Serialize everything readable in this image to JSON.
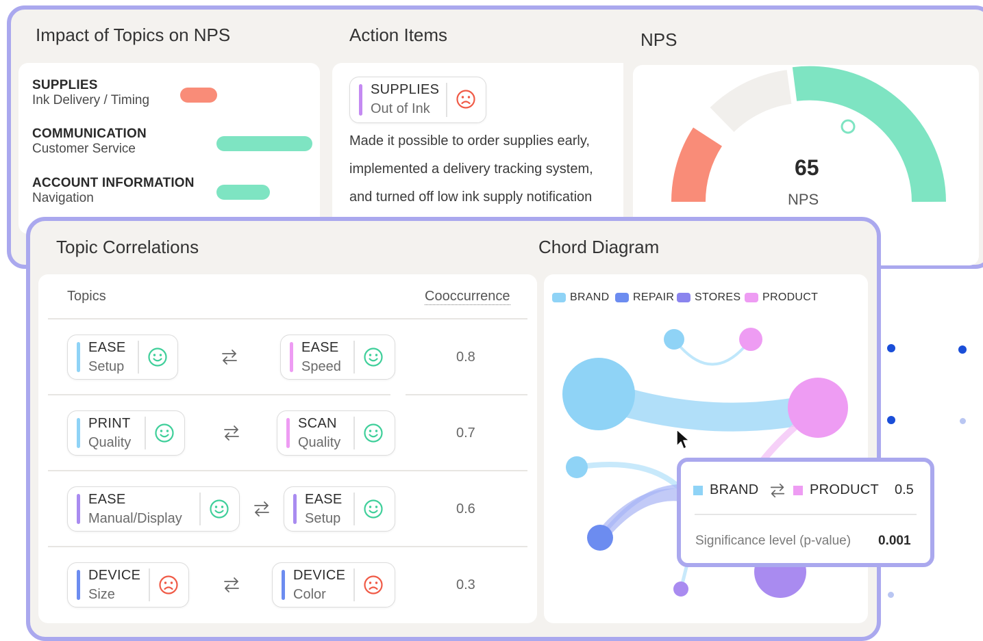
{
  "impact": {
    "title": "Impact of Topics on NPS",
    "items": [
      {
        "category": "SUPPLIES",
        "subtopic": "Ink Delivery / Timing",
        "impact": -0.35,
        "color": "#f98c78"
      },
      {
        "category": "COMMUNICATION",
        "subtopic": "Customer Service",
        "impact": 0.9,
        "color": "#7ee4c2"
      },
      {
        "category": "ACCOUNT INFORMATION",
        "subtopic": "Navigation",
        "impact": 0.5,
        "color": "#7ee4c2"
      }
    ]
  },
  "actions": {
    "title": "Action Items",
    "tag": {
      "category": "SUPPLIES",
      "subtopic": "Out of Ink",
      "sentiment": "negative",
      "color": "#c48af2"
    },
    "text_lines": [
      "Made it possible to order supplies early,",
      "implemented a delivery tracking system,",
      "and turned off low ink supply notification"
    ]
  },
  "nps": {
    "title": "NPS",
    "value": "65",
    "label": "NPS",
    "colors": {
      "detractor": "#f98c78",
      "passive": "#f1efec",
      "promoter": "#7ee4c2"
    }
  },
  "correlations": {
    "title": "Topic Correlations",
    "header_topics": "Topics",
    "header_value": "Cooccurrence",
    "rows": [
      {
        "a": {
          "category": "EASE",
          "subtopic": "Setup",
          "sentiment": "positive",
          "color": "#8fd3f6"
        },
        "b": {
          "category": "EASE",
          "subtopic": "Speed",
          "sentiment": "positive",
          "color": "#ee9cf3"
        },
        "value": "0.8"
      },
      {
        "a": {
          "category": "PRINT",
          "subtopic": "Quality",
          "sentiment": "positive",
          "color": "#8fd3f6"
        },
        "b": {
          "category": "SCAN",
          "subtopic": "Quality",
          "sentiment": "positive",
          "color": "#ee9cf3"
        },
        "value": "0.7"
      },
      {
        "a": {
          "category": "EASE",
          "subtopic": "Manual/Display",
          "sentiment": "positive",
          "color": "#a98bf0"
        },
        "b": {
          "category": "EASE",
          "subtopic": "Setup",
          "sentiment": "positive",
          "color": "#a98bf0"
        },
        "value": "0.6"
      },
      {
        "a": {
          "category": "DEVICE",
          "subtopic": "Size",
          "sentiment": "negative",
          "color": "#6c8cf0"
        },
        "b": {
          "category": "DEVICE",
          "subtopic": "Color",
          "sentiment": "negative",
          "color": "#6c8cf0"
        },
        "value": "0.3"
      }
    ]
  },
  "chord": {
    "title": "Chord Diagram",
    "legend": [
      {
        "label": "BRAND",
        "color": "#8fd3f6"
      },
      {
        "label": "REPAIR",
        "color": "#6c8cf0"
      },
      {
        "label": "STORES",
        "color": "#8a84ee"
      },
      {
        "label": "PRODUCT",
        "color": "#ee9cf3"
      }
    ],
    "tooltip": {
      "a": "BRAND",
      "b": "PRODUCT",
      "a_color": "#8fd3f6",
      "b_color": "#ee9cf3",
      "value": "0.5",
      "sig_label": "Significance level (p-value)",
      "sig_value": "0.001"
    }
  },
  "colors": {
    "panel_border": "#aaa8ee",
    "panel_bg": "#f4f2ef",
    "positive_face": "#3fcf9a",
    "negative_face": "#f05a46"
  }
}
